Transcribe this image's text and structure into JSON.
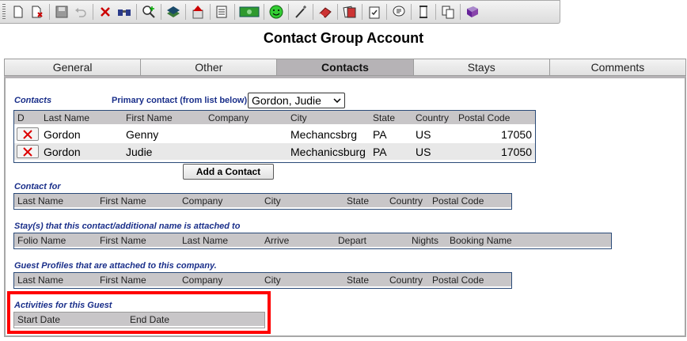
{
  "toolbar": {
    "icons": [
      "new-icon",
      "new-copy-icon",
      "save-icon",
      "undo-icon",
      "delete-icon",
      "binoculars-icon",
      "find-add-icon",
      "stack-icon",
      "upload-icon",
      "print-list-icon",
      "money-icon",
      "smiley-icon",
      "wand-icon",
      "eraser-icon",
      "cards-icon",
      "clipboard-check-icon",
      "speech-icon",
      "scroll-icon",
      "document-copy-icon",
      "book-icon"
    ]
  },
  "page": {
    "title": "Contact Group Account"
  },
  "tabs": [
    {
      "label": "General"
    },
    {
      "label": "Other"
    },
    {
      "label": "Contacts"
    },
    {
      "label": "Stays"
    },
    {
      "label": "Comments"
    }
  ],
  "contacts": {
    "section_label": "Contacts",
    "primary_label": "Primary contact (from list below)",
    "primary_value": "Gordon, Judie",
    "headers": [
      "D",
      "Last Name",
      "First Name",
      "Company",
      "City",
      "State",
      "Country",
      "Postal Code"
    ],
    "rows": [
      {
        "last": "Gordon",
        "first": "Genny",
        "company": "",
        "city": "Mechancsbrg",
        "state": "PA",
        "country": "US",
        "postal": "17050"
      },
      {
        "last": "Gordon",
        "first": "Judie",
        "company": "",
        "city": "Mechanicsburg",
        "state": "PA",
        "country": "US",
        "postal": "17050"
      }
    ],
    "add_label": "Add a Contact"
  },
  "contact_for": {
    "section_label": "Contact for",
    "headers": [
      "Last Name",
      "First Name",
      "Company",
      "City",
      "State",
      "Country",
      "Postal Code"
    ]
  },
  "stays": {
    "section_label": "Stay(s) that this contact/additional name is attached to",
    "headers": [
      "Folio Name",
      "First Name",
      "Last Name",
      "Arrive",
      "Depart",
      "Nights",
      "Booking Name"
    ]
  },
  "guest_profiles": {
    "section_label": "Guest Profiles that are attached to this company.",
    "headers": [
      "Last Name",
      "First Name",
      "Company",
      "City",
      "State",
      "Country",
      "Postal Code"
    ]
  },
  "activities": {
    "section_label": "Activities for this Guest",
    "headers": [
      "Start Date",
      "End Date"
    ]
  },
  "colors": {
    "accent": "#1a2f8a",
    "highlight": "#ff0000",
    "active_tab": "#b6b3b6"
  }
}
